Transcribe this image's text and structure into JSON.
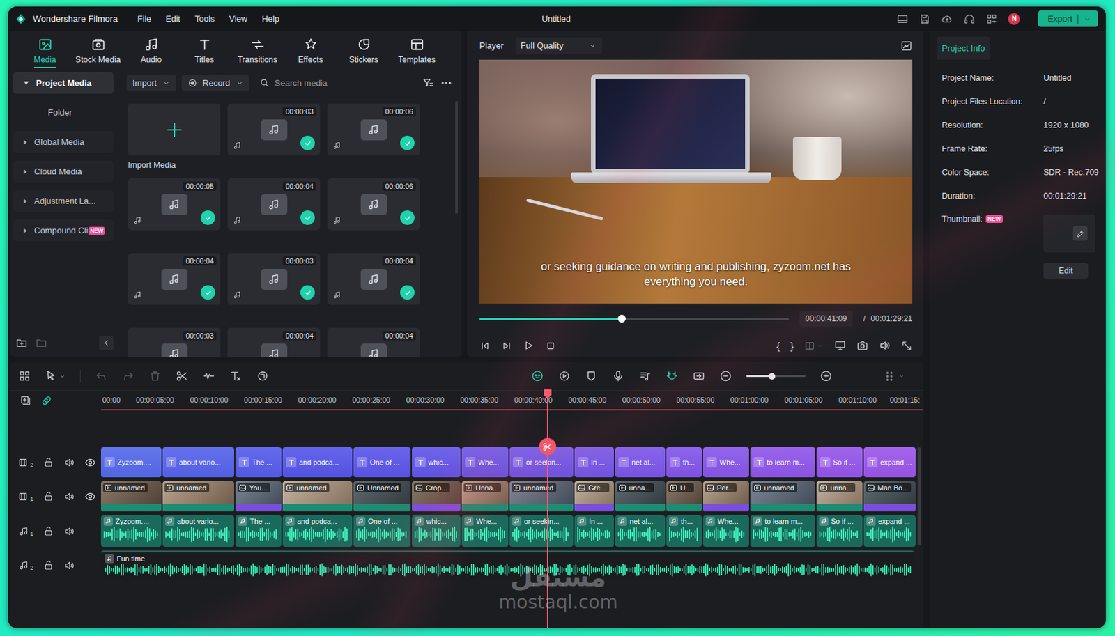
{
  "window": {
    "app_name": "Wondershare Filmora",
    "title": "Untitled",
    "menu": [
      "File",
      "Edit",
      "Tools",
      "View",
      "Help"
    ],
    "avatar": "N",
    "export": "Export"
  },
  "media_tabs": [
    {
      "label": "Media",
      "selected": true
    },
    {
      "label": "Stock Media",
      "selected": false
    },
    {
      "label": "Audio",
      "selected": false
    },
    {
      "label": "Titles",
      "selected": false
    },
    {
      "label": "Transitions",
      "selected": false
    },
    {
      "label": "Effects",
      "selected": false
    },
    {
      "label": "Stickers",
      "selected": false
    },
    {
      "label": "Templates",
      "selected": false
    }
  ],
  "media_sidebar": [
    {
      "label": "Project Media",
      "kind": "group",
      "expanded": true,
      "selected": true
    },
    {
      "label": "Folder",
      "kind": "folder",
      "selected": false
    },
    {
      "label": "Global Media",
      "kind": "group",
      "expanded": false,
      "selected": false
    },
    {
      "label": "Cloud Media",
      "kind": "group",
      "expanded": false,
      "selected": false
    },
    {
      "label": "Adjustment La...",
      "kind": "group",
      "expanded": false,
      "selected": false
    },
    {
      "label": "Compound Clip",
      "kind": "group",
      "expanded": false,
      "selected": false,
      "badge": "NEW"
    }
  ],
  "media_toolbar": {
    "import": "Import",
    "record": "Record",
    "search_placeholder": "Search media"
  },
  "import_tile": {
    "label": "Import Media"
  },
  "media_items": [
    {
      "duration": "00:00:03",
      "checked": true
    },
    {
      "duration": "00:00:06",
      "checked": true
    },
    {
      "duration": "00:00:05",
      "checked": true
    },
    {
      "duration": "00:00:04",
      "checked": true
    },
    {
      "duration": "00:00:06",
      "checked": true
    },
    {
      "duration": "00:00:04",
      "checked": true
    },
    {
      "duration": "00:00:03",
      "checked": true
    },
    {
      "duration": "00:00:04",
      "checked": true
    },
    {
      "duration": "00:00:03",
      "checked": false
    },
    {
      "duration": "00:00:04",
      "checked": false
    },
    {
      "duration": "00:00:04",
      "checked": false
    }
  ],
  "player": {
    "label": "Player",
    "quality": "Full Quality",
    "caption": "or seeking guidance on writing and publishing, zyzoom.net has everything you need.",
    "level": 0.46,
    "current": "00:00:41:09",
    "separator": "/",
    "total": "00:01:29:21",
    "mark_in": "{",
    "mark_out": "}"
  },
  "project_info": {
    "tab": {
      "label": "Project Info",
      "selected": true
    },
    "rows": [
      {
        "label": "Project Name:",
        "value": "Untitled"
      },
      {
        "label": "Project Files Location:",
        "value": "/"
      },
      {
        "label": "Resolution:",
        "value": "1920 x 1080"
      },
      {
        "label": "Frame Rate:",
        "value": "25fps"
      },
      {
        "label": "Color Space:",
        "value": "SDR - Rec.709"
      },
      {
        "label": "Duration:",
        "value": "00:01:29:21"
      }
    ],
    "thumbnail": {
      "label": "Thumbnail:",
      "badge": "NEW"
    },
    "edit": "Edit"
  },
  "timeline": {
    "link_on": true,
    "snap_on": true,
    "undo_disabled": true,
    "redo_disabled": true,
    "delete_disabled": true,
    "zoom_level": 0.43,
    "ruler": [
      "00:00",
      "00:00:05:00",
      "00:00:10:00",
      "00:00:15:00",
      "00:00:20:00",
      "00:00:25:00",
      "00:00:30:00",
      "00:00:35:00",
      "00:00:40:00",
      "00:00:45:00",
      "00:00:50:00",
      "00:00:55:00",
      "00:01:00:00",
      "00:01:05:00",
      "00:01:10:00",
      "00:01:15:"
    ],
    "tracks": [
      {
        "kind": "title",
        "number": "2",
        "visible": true,
        "clips": [
          {
            "label": "Zyzoom...."
          },
          {
            "label": "about vario..."
          },
          {
            "label": "The ..."
          },
          {
            "label": "and podca..."
          },
          {
            "label": "One of ..."
          },
          {
            "label": "whic..."
          },
          {
            "label": "Whe..."
          },
          {
            "label": "or seekin..."
          },
          {
            "label": "In ..."
          },
          {
            "label": "net al..."
          },
          {
            "label": "th..."
          },
          {
            "label": "Whe..."
          },
          {
            "label": "to learn m..."
          },
          {
            "label": "So if ..."
          },
          {
            "label": "expand ..."
          }
        ]
      },
      {
        "kind": "video",
        "number": "1",
        "visible": true,
        "clips": [
          {
            "label": "unnamed",
            "kind": "video"
          },
          {
            "label": "unnamed",
            "kind": "video"
          },
          {
            "label": "You...",
            "kind": "image"
          },
          {
            "label": "unnamed",
            "kind": "video"
          },
          {
            "label": "Unnamed",
            "kind": "video"
          },
          {
            "label": "Crop...",
            "kind": "image"
          },
          {
            "label": "Unna...",
            "kind": "video"
          },
          {
            "label": "unnamed",
            "kind": "video"
          },
          {
            "label": "Gre...",
            "kind": "image"
          },
          {
            "label": "unna...",
            "kind": "video"
          },
          {
            "label": "U...",
            "kind": "video"
          },
          {
            "label": "Per...",
            "kind": "image"
          },
          {
            "label": "unnamed",
            "kind": "video"
          },
          {
            "label": "unna...",
            "kind": "video"
          },
          {
            "label": "Man Bo...",
            "kind": "image"
          }
        ]
      },
      {
        "kind": "audio",
        "number": "1",
        "clips": [
          {
            "label": "Zyzoom...."
          },
          {
            "label": "about vario..."
          },
          {
            "label": "The ..."
          },
          {
            "label": "and podca..."
          },
          {
            "label": "One of ..."
          },
          {
            "label": "whic..."
          },
          {
            "label": "Whe..."
          },
          {
            "label": "or seekin..."
          },
          {
            "label": "In ..."
          },
          {
            "label": "net al..."
          },
          {
            "label": "th..."
          },
          {
            "label": "Whe..."
          },
          {
            "label": "to learn m..."
          },
          {
            "label": "So if ..."
          },
          {
            "label": "expand ..."
          }
        ]
      },
      {
        "kind": "music",
        "number": "2",
        "clips": [
          {
            "label": "Fun time"
          }
        ]
      }
    ]
  },
  "watermark": {
    "logo": "مستقل",
    "text": "mostaql.com"
  }
}
